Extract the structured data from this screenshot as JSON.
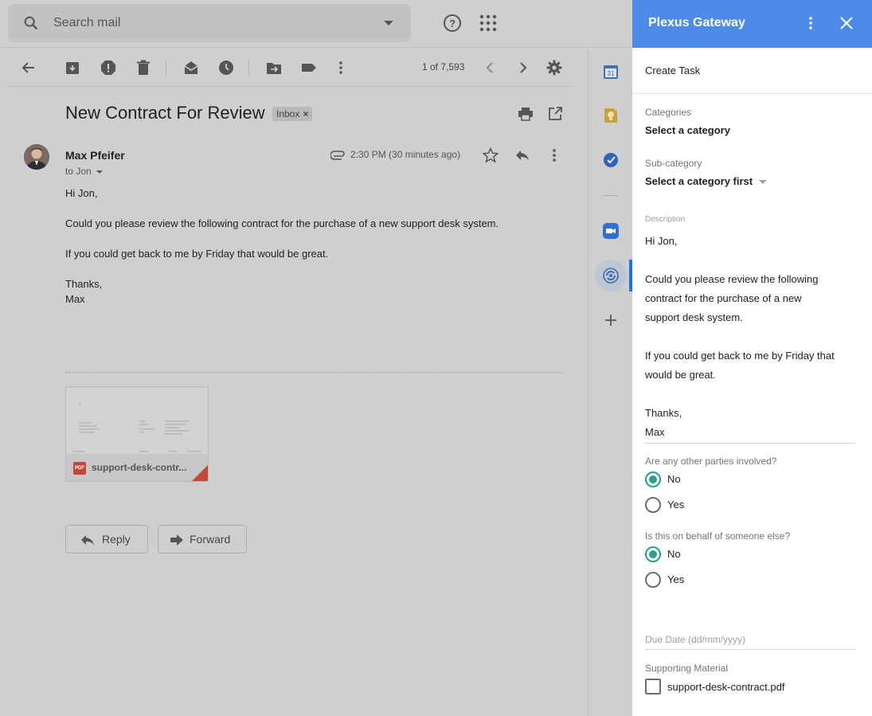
{
  "search": {
    "placeholder": "Search mail"
  },
  "toolbar": {
    "pager": "1 of 7,593"
  },
  "email": {
    "subject": "New Contract For Review",
    "label": "Inbox",
    "label_close": "×",
    "sender": "Max Pfeifer",
    "to": "to Jon",
    "time": "2:30 PM (30 minutes ago)",
    "body": [
      "Hi Jon,",
      "Could you please review the following contract for the purchase of a new support desk system.",
      "If you could get back to me by Friday that would be great.",
      "Thanks,",
      "Max"
    ],
    "attachment": {
      "badge": "PDF",
      "name": "support-desk-contr..."
    },
    "reply_label": "Reply",
    "forward_label": "Forward"
  },
  "panel": {
    "title": "Plexus Gateway",
    "header_color": "#4e8ae8",
    "create_task": "Create Task",
    "categories_label": "Categories",
    "categories_value": "Select a category",
    "subcategory_label": "Sub-category",
    "subcategory_value": "Select a category first",
    "description_label": "Description",
    "description": [
      "Hi Jon,",
      "Could you please review the following",
      "contract for the purchase of a new",
      "support desk system.",
      "If you could get back to me by Friday that",
      "would be great.",
      "Thanks,",
      "Max"
    ],
    "q1": {
      "label": "Are any other parties involved?",
      "no": "No",
      "yes": "Yes",
      "selected": "No"
    },
    "q2": {
      "label": "Is this on behalf of someone else?",
      "no": "No",
      "yes": "Yes",
      "selected": "No"
    },
    "due_date_placeholder": "Due Date (dd/mm/yyyy)",
    "supporting_label": "Supporting Material",
    "supporting_file": "support-desk-contract.pdf",
    "accent_color": "#26a08a"
  }
}
